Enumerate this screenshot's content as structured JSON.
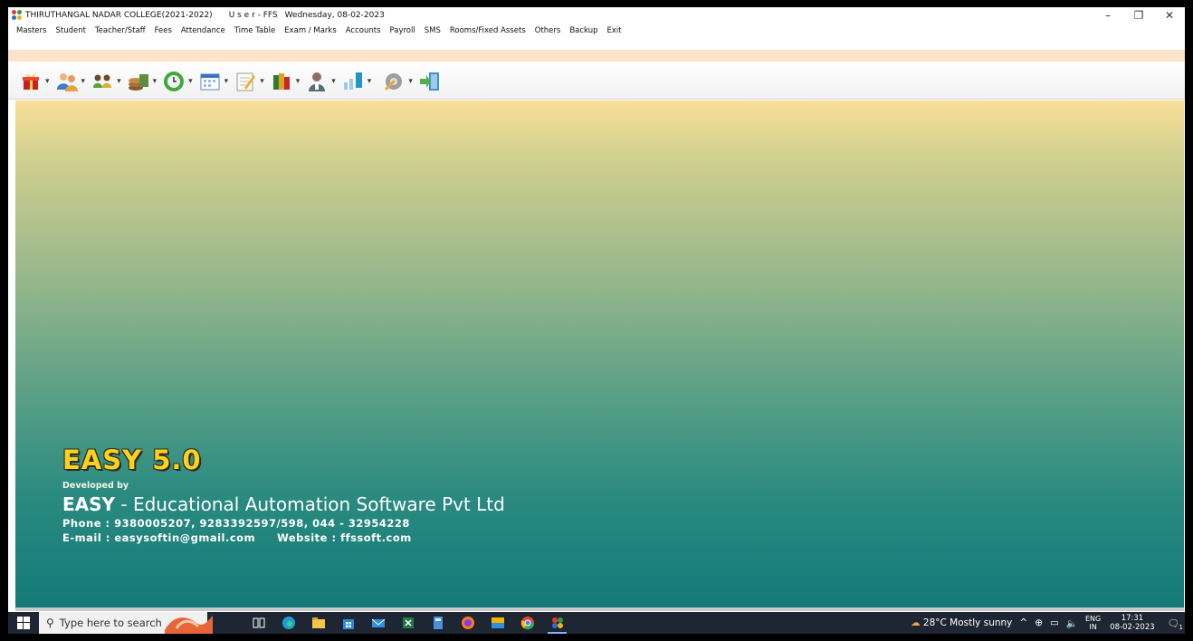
{
  "window": {
    "title_app": "THIRUTHANGAL NADAR COLLEGE(2021-2022)",
    "title_user": "U s e r - FFS",
    "title_date": "Wednesday, 08-02-2023",
    "controls": {
      "minimize": "–",
      "restore": "❐",
      "close": "✕"
    }
  },
  "menu": [
    "Masters",
    "Student",
    "Teacher/Staff",
    "Fees",
    "Attendance",
    "Time Table",
    "Exam / Marks",
    "Accounts",
    "Payroll",
    "SMS",
    "Rooms/Fixed Assets",
    "Others",
    "Backup",
    "Exit"
  ],
  "toolbar": {
    "dropdown_glyph": "▾",
    "buttons": [
      "gift-icon",
      "people-icon",
      "group-icon",
      "money-icon",
      "clock-icon",
      "calendar-icon",
      "notepad-icon",
      "books-icon",
      "teacher-icon",
      "chart-icon",
      "gear-icon",
      "exit-icon"
    ]
  },
  "brand": {
    "title": "EASY 5.0",
    "developed_by": "Developed by",
    "company_bold": "EASY",
    "company_rest": " - Educational Automation Software Pvt Ltd",
    "phone": "Phone : 9380005207, 9283392597/598,  044 - 32954228",
    "email": "E-mail : easysoftin@gmail.com",
    "website": "Website : ffssoft.com"
  },
  "taskbar": {
    "search_placeholder": "Type here to search",
    "weather": "28°C  Mostly sunny",
    "tray_arrow": "^",
    "lang_top": "ENG",
    "lang_bottom": "IN",
    "time": "17:31",
    "date": "08-02-2023",
    "notification_count": "1"
  },
  "colors": {
    "brand_yellow": "#ffd21a",
    "taskbar": "#1f2633",
    "peach_strip": "#fde3c9"
  }
}
